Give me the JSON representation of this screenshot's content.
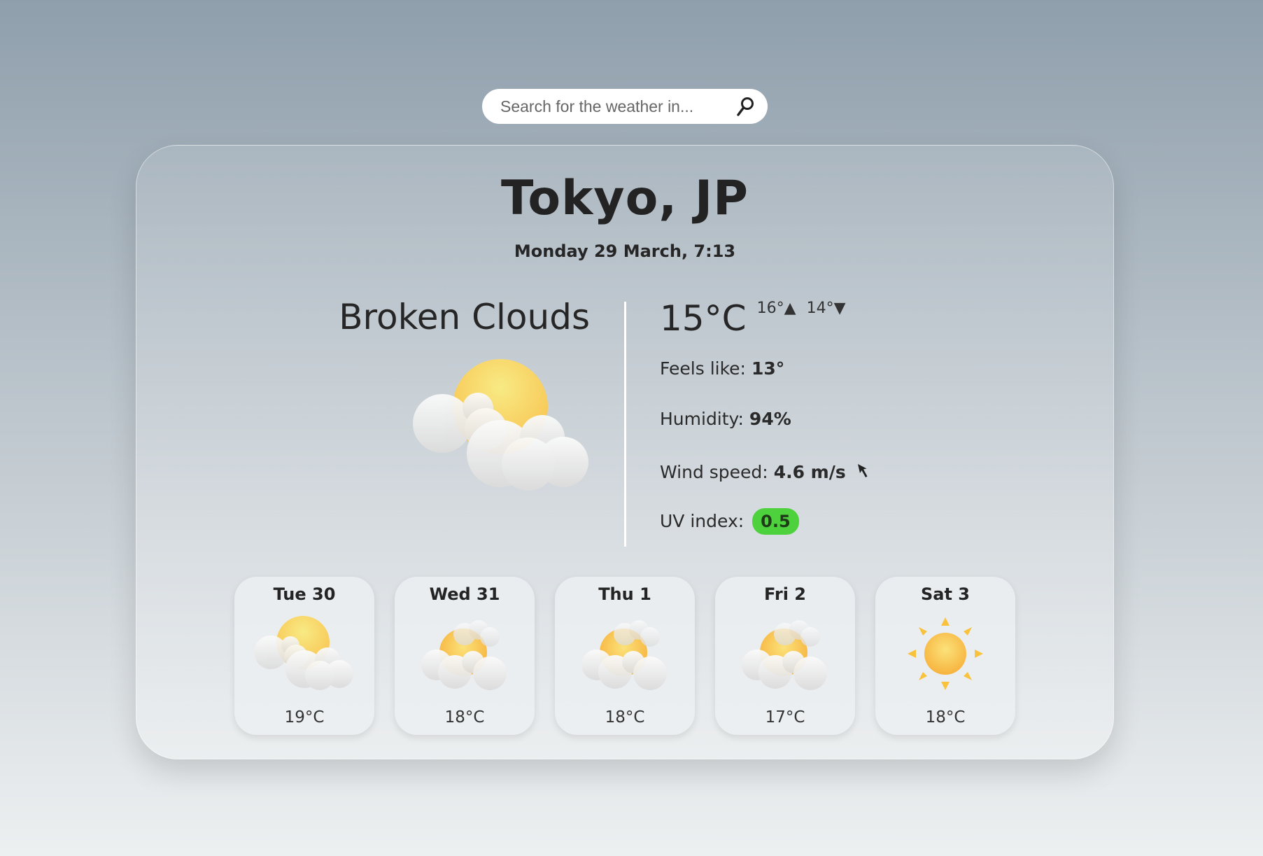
{
  "search": {
    "placeholder": "Search for the weather in...",
    "icon": "search-icon"
  },
  "current": {
    "city": "Tokyo, JP",
    "datetime": "Monday 29 March, 7:13",
    "condition": "Broken Clouds",
    "icon": "broken-clouds-icon",
    "temperature": "15°C",
    "high": "16°",
    "low": "14°",
    "feels_like_label": "Feels like:",
    "feels_like_value": "13°",
    "humidity_label": "Humidity:",
    "humidity_value": "94%",
    "wind_label": "Wind speed:",
    "wind_value": "4.6 m/s",
    "uv_label": "UV index:",
    "uv_value": "0.5",
    "uv_color": "#4dd23d"
  },
  "forecast": [
    {
      "day": "Tue 30",
      "temp": "19°C",
      "icon": "broken-clouds-icon"
    },
    {
      "day": "Wed 31",
      "temp": "18°C",
      "icon": "partly-cloudy-icon"
    },
    {
      "day": "Thu 1",
      "temp": "18°C",
      "icon": "partly-cloudy-icon"
    },
    {
      "day": "Fri 2",
      "temp": "17°C",
      "icon": "partly-cloudy-icon"
    },
    {
      "day": "Sat 3",
      "temp": "18°C",
      "icon": "sun-icon"
    }
  ]
}
